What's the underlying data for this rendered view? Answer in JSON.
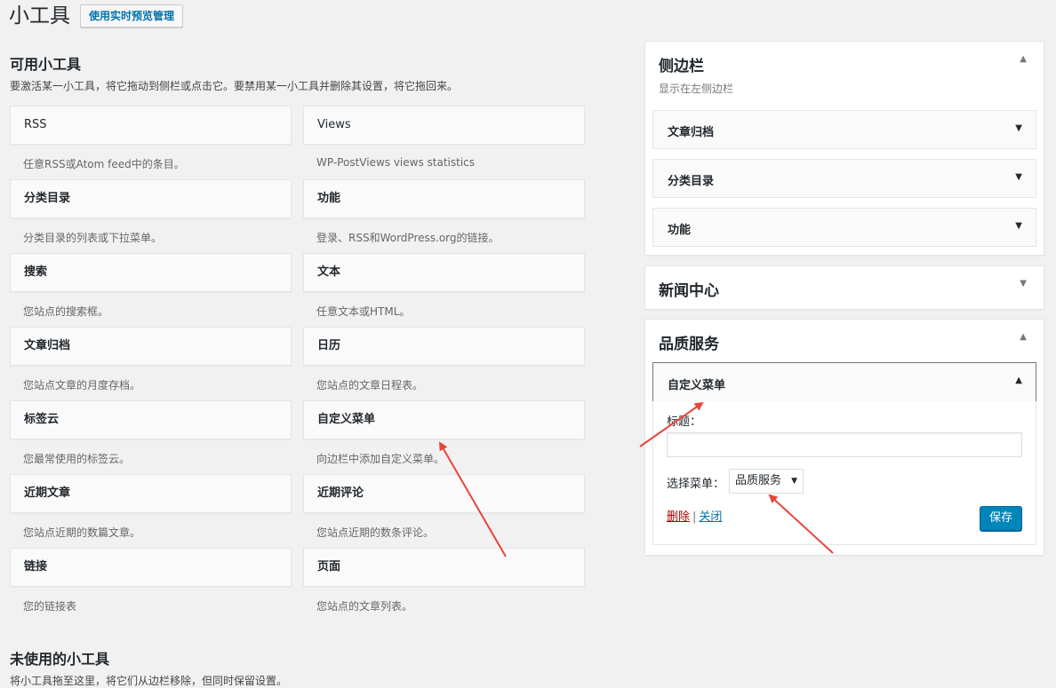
{
  "page": {
    "title": "小工具",
    "live_preview_button": "使用实时预览管理"
  },
  "available": {
    "title": "可用小工具",
    "description": "要激活某一小工具，将它拖动到侧栏或点击它。要禁用某一小工具并删除其设置，将它拖回来。",
    "widgets": [
      {
        "name": "RSS",
        "desc": "任意RSS或Atom feed中的条目。"
      },
      {
        "name": "Views",
        "desc": "WP-PostViews views statistics"
      },
      {
        "name": "分类目录",
        "desc": "分类目录的列表或下拉菜单。"
      },
      {
        "name": "功能",
        "desc": "登录、RSS和WordPress.org的链接。"
      },
      {
        "name": "搜索",
        "desc": "您站点的搜索框。"
      },
      {
        "name": "文本",
        "desc": "任意文本或HTML。"
      },
      {
        "name": "文章归档",
        "desc": "您站点文章的月度存档。"
      },
      {
        "name": "日历",
        "desc": "您站点的文章日程表。"
      },
      {
        "name": "标签云",
        "desc": "您最常使用的标签云。"
      },
      {
        "name": "自定义菜单",
        "desc": "向边栏中添加自定义菜单。"
      },
      {
        "name": "近期文章",
        "desc": "您站点近期的数篇文章。"
      },
      {
        "name": "近期评论",
        "desc": "您站点近期的数条评论。"
      },
      {
        "name": "链接",
        "desc": "您的链接表"
      },
      {
        "name": "页面",
        "desc": "您站点的文章列表。"
      }
    ]
  },
  "unused": {
    "title": "未使用的小工具",
    "description": "将小工具拖至这里，将它们从边栏移除，但同时保留设置。"
  },
  "sidebars": [
    {
      "name": "侧边栏",
      "description": "显示在左侧边栏",
      "toggle": "▲",
      "widgets": [
        "文章归档",
        "分类目录",
        "功能"
      ],
      "widget_arrow": "▼"
    },
    {
      "name": "新闻中心",
      "toggle": "▼"
    },
    {
      "name": "品质服务",
      "toggle": "▲",
      "open_widget": {
        "name": "自定义菜单",
        "arrow": "▲",
        "title_label": "标题：",
        "title_value": "",
        "menu_label": "选择菜单：",
        "menu_selected": "品质服务",
        "menu_caret": "▼",
        "delete_label": "删除",
        "separator": "|",
        "close_label": "关闭",
        "save_label": "保存"
      }
    }
  ],
  "colors": {
    "annotation_arrow": "#e8453c",
    "primary_button": "#0085ba",
    "link": "#0073aa",
    "delete": "#aa0000"
  }
}
